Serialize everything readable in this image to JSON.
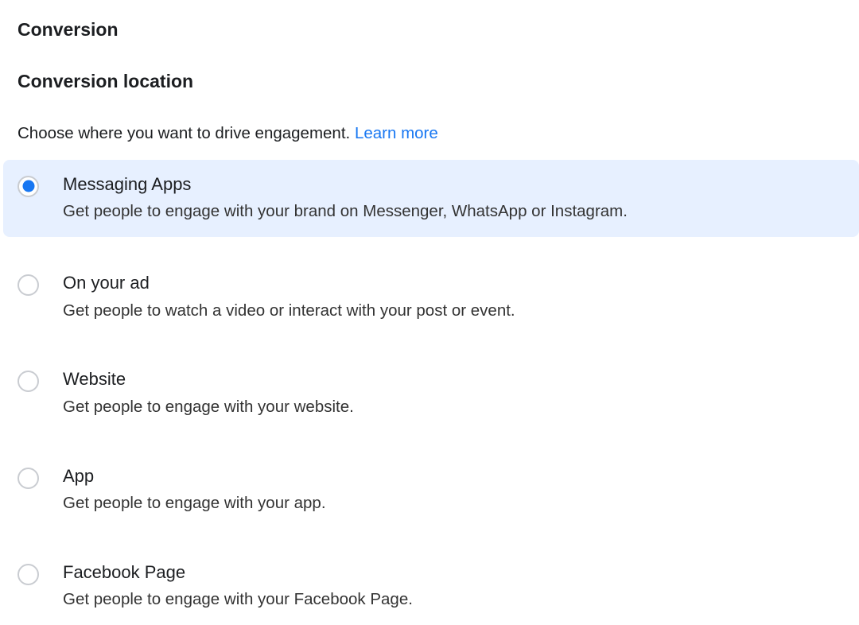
{
  "section": {
    "title": "Conversion",
    "subtitle": "Conversion location",
    "description": "Choose where you want to drive engagement.",
    "learn_more": "Learn more"
  },
  "options": [
    {
      "title": "Messaging Apps",
      "description": "Get people to engage with your brand on Messenger, WhatsApp or Instagram.",
      "selected": true
    },
    {
      "title": "On your ad",
      "description": "Get people to watch a video or interact with your post or event.",
      "selected": false
    },
    {
      "title": "Website",
      "description": "Get people to engage with your website.",
      "selected": false
    },
    {
      "title": "App",
      "description": "Get people to engage with your app.",
      "selected": false
    },
    {
      "title": "Facebook Page",
      "description": "Get people to engage with your Facebook Page.",
      "selected": false
    }
  ]
}
